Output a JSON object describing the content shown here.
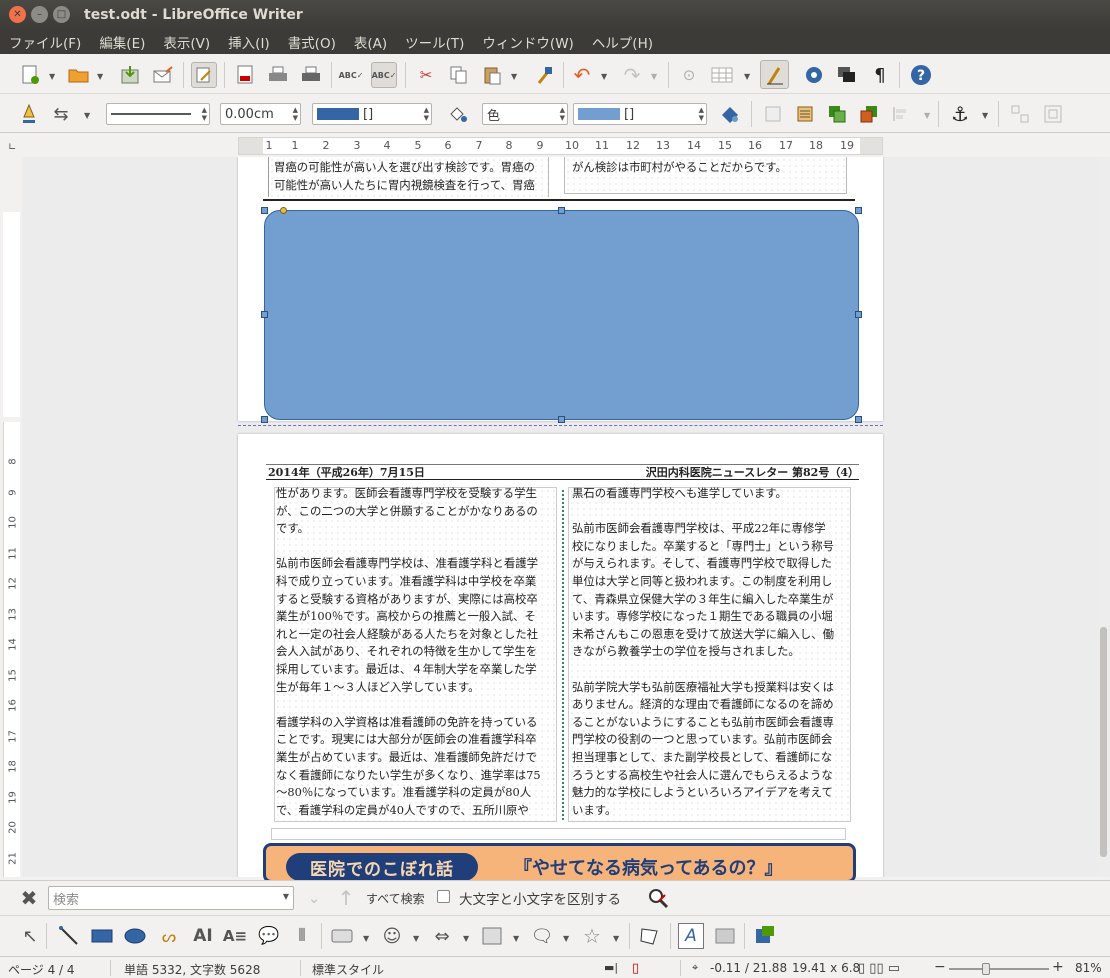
{
  "window": {
    "title": "test.odt - LibreOffice Writer"
  },
  "menu": [
    "ファイル(F)",
    "編集(E)",
    "表示(V)",
    "挿入(I)",
    "書式(O)",
    "表(A)",
    "ツール(T)",
    "ウィンドウ(W)",
    "ヘルプ(H)"
  ],
  "toolbar2": {
    "line_width": "0.00cm",
    "line_color_label": "[]",
    "area_mode": "色",
    "area_color_label": "[]"
  },
  "ruler": {
    "numbers": [
      "1",
      "1",
      "2",
      "3",
      "4",
      "5",
      "6",
      "7",
      "8",
      "9",
      "10",
      "11",
      "12",
      "13",
      "14",
      "15",
      "16",
      "17",
      "18",
      "19"
    ]
  },
  "vruler_numbers": [
    "8",
    "9",
    "10",
    "11",
    "12",
    "13",
    "14",
    "15",
    "16",
    "17",
    "18",
    "19",
    "20",
    "21"
  ],
  "page1": {
    "left_lines": [
      "胃癌の可能性が高い人を選び出す検診です。胃癌の",
      "可能性が高い人たちに胃内視鏡検査を行って、胃癌"
    ],
    "right_lines": [
      "がん検診は市町村がやることだからです。"
    ]
  },
  "page2": {
    "header_left": "2014年（平成26年）7月15日",
    "header_right": "沢田内科医院ニュースレター 第82号（4）",
    "left_text": "性があります。医師会看護専門学校を受験する学生\nが、この二つの大学と併願することがかなりあるの\nです。\n\n弘前市医師会看護専門学校は、准看護学科と看護学\n科で成り立っています。准看護学科は中学校を卒業\nすると受験する資格がありますが、実際には高校卒\n業生が100％です。高校からの推薦と一般入試、そ\nれと一定の社会人経験がある人たちを対象とした社\n会人入試があり、それぞれの特徴を生かして学生を\n採用しています。最近は、４年制大学を卒業した学\n生が毎年１～３人ほど入学しています。\n\n看護学科の入学資格は准看護師の免許を持っている\nことです。現実には大部分が医師会の准看護学科卒\n業生が占めています。最近は、准看護師免許だけで\nなく看護師になりたい学生が多くなり、進学率は75\n～80％になっています。准看護学科の定員が80人\nで、看護学科の定員が40人ですので、五所川原や",
    "right_text": "黒石の看護専門学校へも進学しています。\n\n弘前市医師会看護専門学校は、平成22年に専修学\n校になりました。卒業すると「専門士」という称号\nが与えられます。そして、看護専門学校で取得した\n単位は大学と同等と扱われます。この制度を利用し\nて、青森県立保健大学の３年生に編入した卒業生が\nいます。専修学校になった１期生である職員の小堀\n未希さんもこの恩恵を受けて放送大学に編入し、働\nきながら教養学士の学位を授与されました。\n\n弘前学院大学も弘前医療福祉大学も授業料は安くは\nありません。経済的な理由で看護師になるのを諦め\nることがないようにすることも弘前市医師会看護専\n門学校の役割の一つと思っています。弘前市医師会\n担当理事として、また副学校長として、看護師にな\nろうとする高校生や社会人に選んでもらえるような\n魅力的な学校にしようといろいろアイデアを考えて\nいます。",
    "banner_left": "医院でのこぼれ話",
    "banner_right": "『やせてなる病気ってあるの？』"
  },
  "findbar": {
    "placeholder": "検索",
    "find_all": "すべて検索",
    "match_case": "大文字と小文字を区別する"
  },
  "status": {
    "page": "ページ 4 / 4",
    "words": "単語 5332, 文字数 5628",
    "style": "標準スタイル",
    "position": "-0.11 / 21.88",
    "size": "19.41 x 6.8",
    "zoom": "81%"
  },
  "colors": {
    "shape_fill": "#729fcf",
    "shape_border": "#3465a4",
    "banner_fill": "#f7b47a",
    "banner_navy": "#1f3e7a"
  }
}
